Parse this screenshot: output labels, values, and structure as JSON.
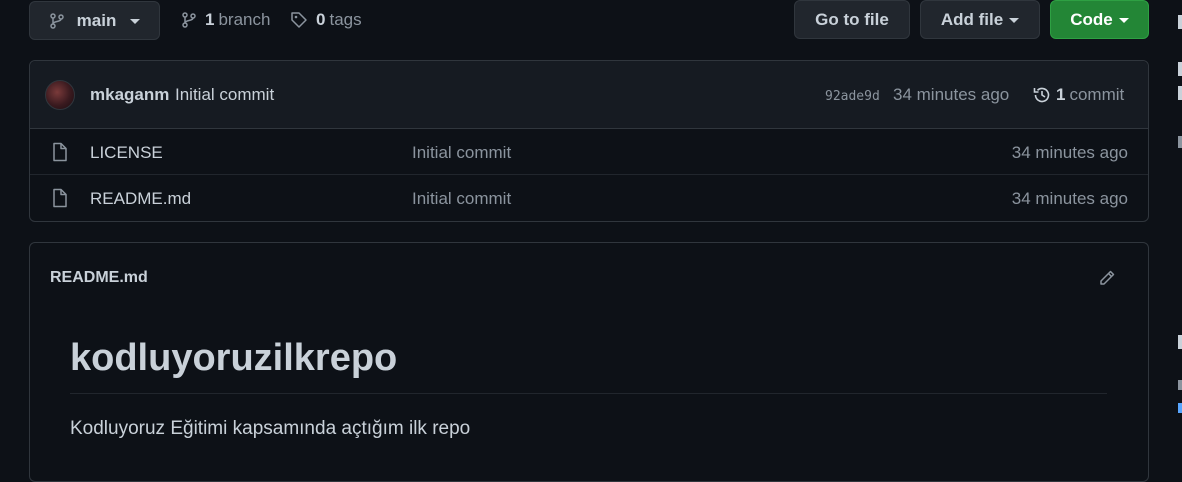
{
  "toolbar": {
    "branch_label": "main",
    "branch_count": "1",
    "branch_word": "branch",
    "tag_count": "0",
    "tag_word": "tags",
    "go_to_file_label": "Go to file",
    "add_file_label": "Add file",
    "code_label": "Code",
    "code_color": "#238636"
  },
  "commit_bar": {
    "author": "mkaganm",
    "message": "Initial commit",
    "sha": "92ade9d",
    "time": "34 minutes ago",
    "commit_count": "1",
    "commit_word": "commit"
  },
  "files": [
    {
      "icon": "file-icon",
      "name": "LICENSE",
      "message": "Initial commit",
      "time": "34 minutes ago"
    },
    {
      "icon": "file-icon",
      "name": "README.md",
      "message": "Initial commit",
      "time": "34 minutes ago"
    }
  ],
  "readme": {
    "filename": "README.md",
    "heading": "kodluyoruzilkrepo",
    "paragraph": "Kodluyoruz Eğitimi kapsamında açtığım ilk repo"
  }
}
